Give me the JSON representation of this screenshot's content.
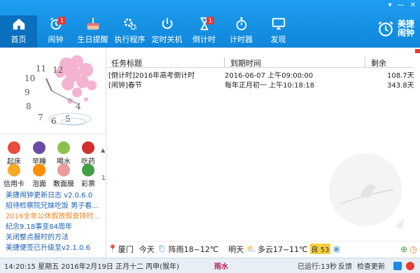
{
  "window": {
    "minimize": "—",
    "close": "✕",
    "menu": "▾"
  },
  "nav": [
    {
      "id": "home",
      "label": "首页",
      "icon": "home-icon",
      "active": true
    },
    {
      "id": "alarm",
      "label": "闹钟",
      "icon": "alarm-clock-icon",
      "badge": "1"
    },
    {
      "id": "birthday",
      "label": "生日提醒",
      "icon": "cake-icon"
    },
    {
      "id": "run",
      "label": "执行程序",
      "icon": "gears-icon"
    },
    {
      "id": "shutdown",
      "label": "定时关机",
      "icon": "power-icon"
    },
    {
      "id": "countdown",
      "label": "倒计时",
      "icon": "hourglass-icon",
      "badge": "1"
    },
    {
      "id": "timer",
      "label": "计时器",
      "icon": "stopwatch-icon"
    },
    {
      "id": "discover",
      "label": "发现",
      "icon": "monitor-icon"
    }
  ],
  "brand": {
    "line1": "美捷",
    "line2": "闹钟"
  },
  "clock": {
    "numbers": [
      "12",
      "11",
      "10",
      "9",
      "8",
      "7",
      "6",
      "5",
      "4"
    ]
  },
  "apps": [
    {
      "label": "起床",
      "color": "#e94b3c"
    },
    {
      "label": "早睡",
      "color": "#6a4ca8"
    },
    {
      "label": "喝水",
      "color": "#8bc34a"
    },
    {
      "label": "吃药",
      "color": "#d32f2f"
    },
    {
      "label": "信用卡",
      "color": "#f9a825"
    },
    {
      "label": "泡面",
      "color": "#ff8f00"
    },
    {
      "label": "敷面膜",
      "color": "#ef9a9a"
    },
    {
      "label": "彩票",
      "color": "#43a047"
    }
  ],
  "apps_page": "1",
  "news": [
    {
      "text": "美捷闹钟更新日志 v2.0.6.0",
      "color": "blue"
    },
    {
      "text": "招待检察院兄妹吃饭 男子看...",
      "color": "blue"
    },
    {
      "text": "2016全年公休假放假安排时...",
      "color": "orange"
    },
    {
      "text": "纪念9.18事变84周年",
      "color": "blue"
    },
    {
      "text": "关闭整点报时的方法",
      "color": "blue"
    },
    {
      "text": "美捷便签已升级至v2.1.0.6",
      "color": "blue"
    }
  ],
  "table": {
    "headers": {
      "title": "任务标题",
      "due": "到期时间",
      "remain": "剩余"
    },
    "rows": [
      {
        "title": "[倒计时]2016年高考倒计时",
        "due": "2016-06-07 上午09:00:00",
        "remain": "108.7天"
      },
      {
        "title": "[闹钟]春节",
        "due": "每年正月初一 上午10:18:18",
        "remain": "343.8天"
      }
    ]
  },
  "weather": {
    "city": "厦门",
    "today_label": "今天",
    "today": "阵雨18~12℃",
    "tomorrow_label": "明天",
    "tomorrow": "多云17~11℃",
    "aqi_label": "良",
    "aqi": "53"
  },
  "footer": {
    "datetime": "14:20:15 星期五 2016年2月19日 正月十二 丙申(猴年)",
    "solar_term": "雨水",
    "runtime": "已运行:13秒",
    "feedback": "反馈",
    "check_update": "检查更新"
  }
}
